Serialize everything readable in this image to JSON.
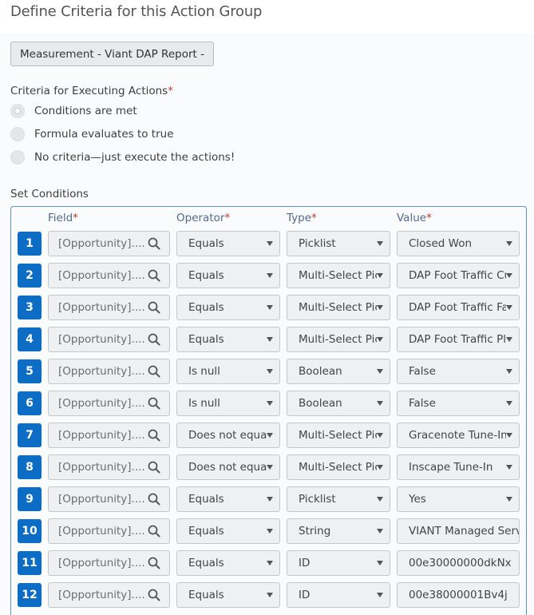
{
  "title": "Define Criteria for this Action Group",
  "group_button": "Measurement - Viant DAP Report -",
  "criteria": {
    "label": "Criteria for Executing Actions",
    "required_mark": "*",
    "options": [
      {
        "label": "Conditions are met",
        "checked": true
      },
      {
        "label": "Formula evaluates to true",
        "checked": false
      },
      {
        "label": "No criteria—just execute the actions!",
        "checked": false
      }
    ]
  },
  "conditions": {
    "label": "Set Conditions",
    "headers": {
      "field": "Field",
      "operator": "Operator",
      "type": "Type",
      "value": "Value",
      "required_mark": "*"
    },
    "rows": [
      {
        "num": "1",
        "field": "[Opportunity]....",
        "operator": "Equals",
        "type": "Picklist",
        "value": "Closed Won",
        "value_dropdown": true
      },
      {
        "num": "2",
        "field": "[Opportunity]....",
        "operator": "Equals",
        "type": "Multi-Select Picklist",
        "value": "DAP Foot Traffic Custom",
        "value_dropdown": true
      },
      {
        "num": "3",
        "field": "[Opportunity]....",
        "operator": "Equals",
        "type": "Multi-Select Picklist",
        "value": "DAP Foot Traffic Factual",
        "value_dropdown": true
      },
      {
        "num": "4",
        "field": "[Opportunity]....",
        "operator": "Equals",
        "type": "Multi-Select Picklist",
        "value": "DAP Foot Traffic Placed",
        "value_dropdown": true
      },
      {
        "num": "5",
        "field": "[Opportunity]....",
        "operator": "Is null",
        "type": "Boolean",
        "value": "False",
        "value_dropdown": true
      },
      {
        "num": "6",
        "field": "[Opportunity]....",
        "operator": "Is null",
        "type": "Boolean",
        "value": "False",
        "value_dropdown": true
      },
      {
        "num": "7",
        "field": "[Opportunity]....",
        "operator": "Does not equal",
        "type": "Multi-Select Picklist",
        "value": "Gracenote Tune-In",
        "value_dropdown": true
      },
      {
        "num": "8",
        "field": "[Opportunity]....",
        "operator": "Does not equal",
        "type": "Multi-Select Picklist",
        "value": "Inscape Tune-In",
        "value_dropdown": true
      },
      {
        "num": "9",
        "field": "[Opportunity]....",
        "operator": "Equals",
        "type": "Picklist",
        "value": "Yes",
        "value_dropdown": true
      },
      {
        "num": "10",
        "field": "[Opportunity]....",
        "operator": "Equals",
        "type": "String",
        "value": "VIANT Managed Service",
        "value_dropdown": false
      },
      {
        "num": "11",
        "field": "[Opportunity]....",
        "operator": "Equals",
        "type": "ID",
        "value": "00e30000000dkNx",
        "value_dropdown": false
      },
      {
        "num": "12",
        "field": "[Opportunity]....",
        "operator": "Equals",
        "type": "ID",
        "value": "00e38000001Bv4j",
        "value_dropdown": false
      }
    ]
  },
  "colors": {
    "accent": "#0d6dc4",
    "border_focus": "#5d90c7",
    "required": "#c23934"
  }
}
